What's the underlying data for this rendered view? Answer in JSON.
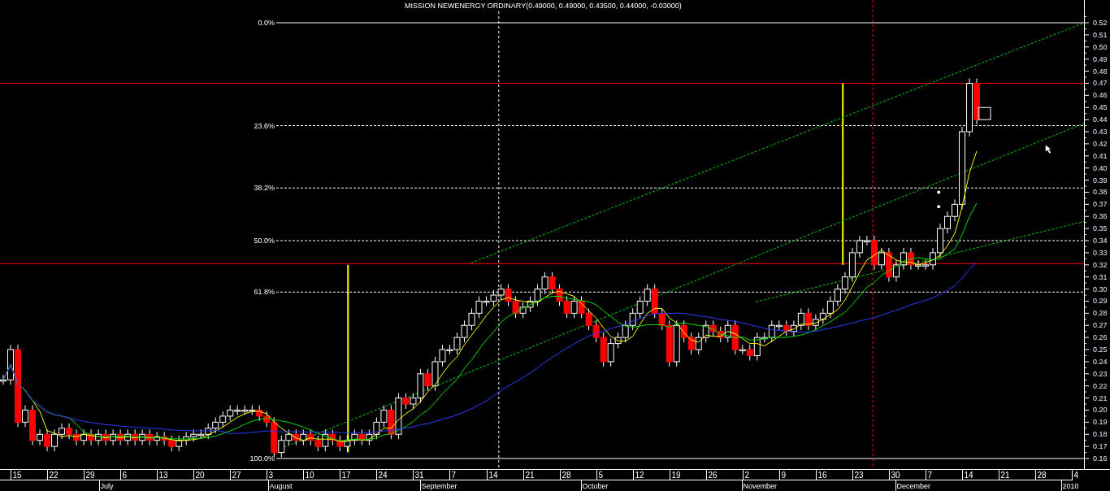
{
  "chart": {
    "title": "MISSION NEWENERGY ORDINARY(0.49000, 0.49000, 0.43500, 0.44000, -0.03000)",
    "fib_levels": [
      "0.0%",
      "23.6%",
      "38.2%",
      "50.0%",
      "61.8%",
      "100.0%"
    ],
    "price_axis": [
      "0.52",
      "0.51",
      "0.50",
      "0.49",
      "0.48",
      "0.47",
      "0.46",
      "0.45",
      "0.44",
      "0.43",
      "0.42",
      "0.41",
      "0.40",
      "0.39",
      "0.38",
      "0.37",
      "0.36",
      "0.35",
      "0.34",
      "0.33",
      "0.32",
      "0.31",
      "0.30",
      "0.29",
      "0.28",
      "0.27",
      "0.26",
      "0.25",
      "0.24",
      "0.23",
      "0.22",
      "0.21",
      "0.20",
      "0.19",
      "0.18",
      "0.17",
      "0.16"
    ],
    "days": [
      "15",
      "22",
      "29",
      "6",
      "13",
      "20",
      "27",
      "3",
      "10",
      "17",
      "24",
      "31",
      "7",
      "14",
      "21",
      "28",
      "5",
      "12",
      "19",
      "26",
      "2",
      "9",
      "16",
      "23",
      "30",
      "7",
      "14",
      "21",
      "28",
      "4"
    ],
    "months": [
      "July",
      "August",
      "September",
      "October",
      "November",
      "December",
      "2010"
    ]
  }
}
